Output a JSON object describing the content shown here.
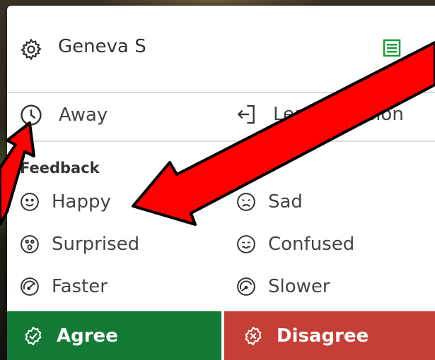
{
  "user": {
    "name": "Geneva S"
  },
  "status": {
    "away_label": "Away",
    "leave_label": "Leave Session"
  },
  "feedback": {
    "title": "Feedback",
    "items": [
      {
        "label": "Happy",
        "icon": "happy-face-icon"
      },
      {
        "label": "Sad",
        "icon": "sad-face-icon"
      },
      {
        "label": "Surprised",
        "icon": "surprised-face-icon"
      },
      {
        "label": "Confused",
        "icon": "confused-face-icon"
      },
      {
        "label": "Faster",
        "icon": "speedometer-fast-icon"
      },
      {
        "label": "Slower",
        "icon": "speedometer-slow-icon"
      }
    ]
  },
  "actions": {
    "agree_label": "Agree",
    "disagree_label": "Disagree"
  },
  "colors": {
    "agree": "#137a36",
    "disagree": "#c53f36",
    "accent": "#1a9b3a",
    "arrow": "#e00000"
  }
}
